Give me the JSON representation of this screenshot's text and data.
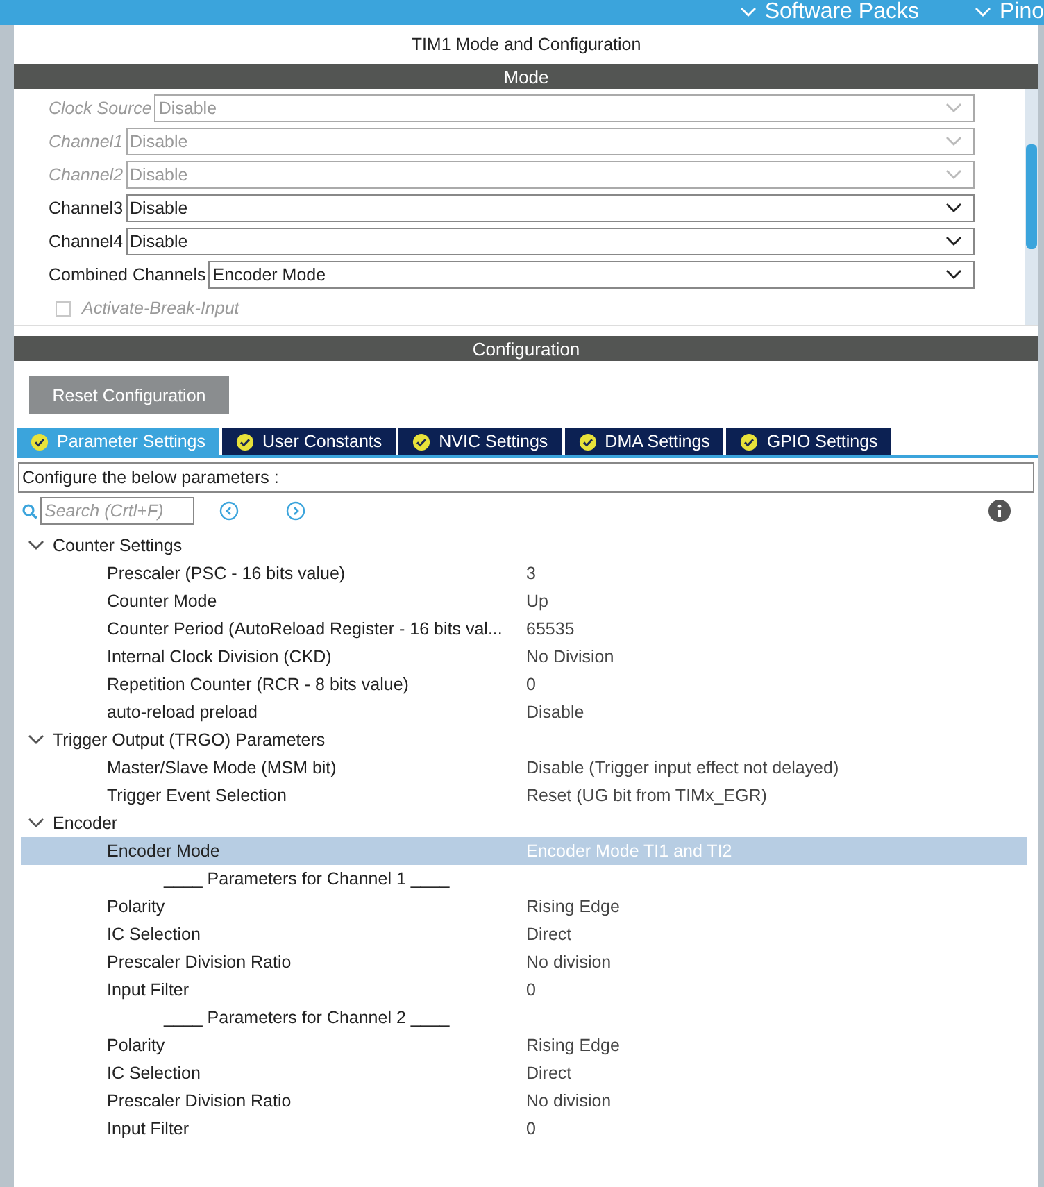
{
  "top_bar": {
    "menus": [
      {
        "label": "Software Packs"
      },
      {
        "label": "Pino"
      }
    ]
  },
  "window": {
    "title": "TIM1 Mode and Configuration"
  },
  "mode": {
    "header": "Mode",
    "rows": [
      {
        "kind": "select",
        "label": "Clock Source",
        "value": "Disable",
        "disabled": true
      },
      {
        "kind": "select",
        "label": "Channel1",
        "value": "Disable",
        "disabled": true
      },
      {
        "kind": "select",
        "label": "Channel2",
        "value": "Disable",
        "disabled": true
      },
      {
        "kind": "select",
        "label": "Channel3",
        "value": "Disable",
        "disabled": false
      },
      {
        "kind": "select",
        "label": "Channel4",
        "value": "Disable",
        "disabled": false
      },
      {
        "kind": "select",
        "label": "Combined Channels",
        "value": "Encoder Mode",
        "disabled": false
      },
      {
        "kind": "checkbox",
        "label": "Activate-Break-Input",
        "checked": false,
        "disabled": true
      }
    ]
  },
  "configuration": {
    "header": "Configuration",
    "reset_button": "Reset Configuration",
    "tabs": [
      {
        "label": "Parameter Settings",
        "selected": true
      },
      {
        "label": "User Constants",
        "selected": false
      },
      {
        "label": "NVIC Settings",
        "selected": false
      },
      {
        "label": "DMA Settings",
        "selected": false
      },
      {
        "label": "GPIO Settings",
        "selected": false
      }
    ],
    "description": "Configure the below parameters :",
    "search": {
      "placeholder": "Search (Crtl+F)"
    },
    "tree": [
      {
        "label": "Counter Settings",
        "expanded": true,
        "children": [
          {
            "kind": "param",
            "label": "Prescaler (PSC - 16 bits value)",
            "value": "3",
            "selected": false
          },
          {
            "kind": "param",
            "label": "Counter Mode",
            "value": "Up",
            "selected": false
          },
          {
            "kind": "param",
            "label": "Counter Period (AutoReload Register - 16 bits val...",
            "value": "65535",
            "selected": false
          },
          {
            "kind": "param",
            "label": "Internal Clock Division (CKD)",
            "value": "No Division",
            "selected": false
          },
          {
            "kind": "param",
            "label": "Repetition Counter (RCR - 8 bits value)",
            "value": "0",
            "selected": false
          },
          {
            "kind": "param",
            "label": "auto-reload preload",
            "value": "Disable",
            "selected": false
          }
        ]
      },
      {
        "label": "Trigger Output (TRGO) Parameters",
        "expanded": true,
        "children": [
          {
            "kind": "param",
            "label": "Master/Slave Mode (MSM bit)",
            "value": "Disable (Trigger input effect not delayed)",
            "selected": false
          },
          {
            "kind": "param",
            "label": "Trigger Event Selection",
            "value": "Reset (UG bit from TIMx_EGR)",
            "selected": false
          }
        ]
      },
      {
        "label": "Encoder",
        "expanded": true,
        "children": [
          {
            "kind": "param",
            "label": "Encoder Mode",
            "value": "Encoder Mode TI1 and TI2",
            "selected": true
          },
          {
            "kind": "subheader",
            "label": "____ Parameters for Channel 1 ____"
          },
          {
            "kind": "param",
            "label": "Polarity",
            "value": "Rising Edge",
            "selected": false
          },
          {
            "kind": "param",
            "label": "IC Selection",
            "value": "Direct",
            "selected": false
          },
          {
            "kind": "param",
            "label": "Prescaler Division Ratio",
            "value": "No division",
            "selected": false
          },
          {
            "kind": "param",
            "label": "Input Filter",
            "value": "0",
            "selected": false
          },
          {
            "kind": "subheader",
            "label": "____ Parameters for Channel 2 ____"
          },
          {
            "kind": "param",
            "label": "Polarity",
            "value": "Rising Edge",
            "selected": false
          },
          {
            "kind": "param",
            "label": "IC Selection",
            "value": "Direct",
            "selected": false
          },
          {
            "kind": "param",
            "label": "Prescaler Division Ratio",
            "value": "No division",
            "selected": false
          },
          {
            "kind": "param",
            "label": "Input Filter",
            "value": "0",
            "selected": false
          }
        ]
      }
    ]
  }
}
